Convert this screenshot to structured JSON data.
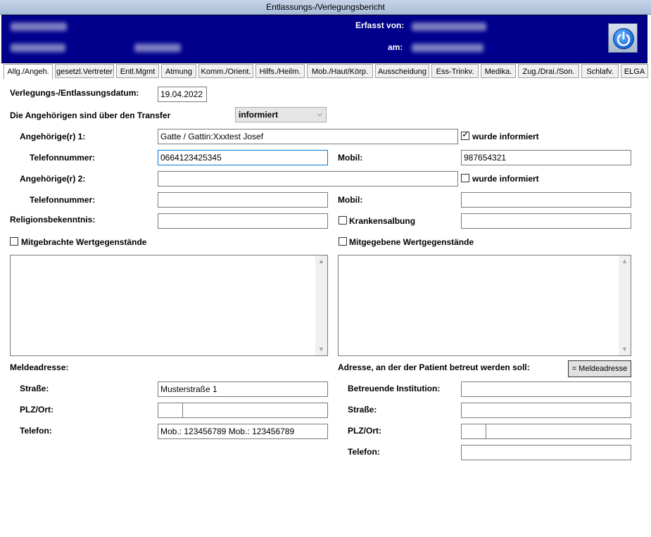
{
  "window": {
    "title": "Entlassungs-/Verlegungsbericht"
  },
  "header": {
    "erfasst_label": "Erfasst von:",
    "am_label": "am:",
    "power_icon": "power-icon"
  },
  "tabs": [
    {
      "label": "Allg./Angeh.",
      "active": true
    },
    {
      "label": "gesetzl.Vertreter"
    },
    {
      "label": "Entl.Mgmt"
    },
    {
      "label": "Atmung"
    },
    {
      "label": "Komm./Orient."
    },
    {
      "label": "Hilfs./Heilm."
    },
    {
      "label": "Mob./Haut/Körp."
    },
    {
      "label": "Ausscheidung"
    },
    {
      "label": "Ess-Trinkv."
    },
    {
      "label": "Medika."
    },
    {
      "label": "Zug./Drai./Son."
    },
    {
      "label": "Schlafv."
    },
    {
      "label": "ELGA"
    }
  ],
  "form": {
    "date_label": "Verlegungs-/Entlassungsdatum:",
    "date_value": "19.04.2022",
    "transfer_label": "Die Angehörigen sind über den Transfer",
    "transfer_select": "informiert",
    "relative1_label": "Angehörige(r) 1:",
    "relative1_value": "Gatte / Gattin:Xxxtest Josef",
    "relative1_informed_label": "wurde informiert",
    "relative1_informed": true,
    "phone1_label": "Telefonnummer:",
    "phone1_value": "0664123425345",
    "mobile1_label": "Mobil:",
    "mobile1_value": "987654321",
    "relative2_label": "Angehörige(r) 2:",
    "relative2_value": "",
    "relative2_informed_label": "wurde informiert",
    "relative2_informed": false,
    "phone2_label": "Telefonnummer:",
    "phone2_value": "",
    "mobile2_label": "Mobil:",
    "mobile2_value": "",
    "religion_label": "Religionsbekenntnis:",
    "religion_value": "",
    "anointing_label": "Krankensalbung",
    "anointing_value": "",
    "valuables_brought_label": "Mitgebrachte Wertgegenstände",
    "valuables_given_label": "Mitgegebene Wertgegenstände",
    "reg_address_label": "Meldeadresse:",
    "care_address_label": "Adresse, an der der Patient betreut werden soll:",
    "copy_address_button": "= Meldeadresse",
    "street_label": "Straße:",
    "street_value": "Musterstraße 1",
    "zip_label": "PLZ/Ort:",
    "phone_label": "Telefon:",
    "phone_value": "Mob.: 123456789 Mob.: 123456789",
    "institution_label": "Betreuende Institution:",
    "care_street_label": "Straße:",
    "care_zip_label": "PLZ/Ort:",
    "care_phone_label": "Telefon:"
  }
}
